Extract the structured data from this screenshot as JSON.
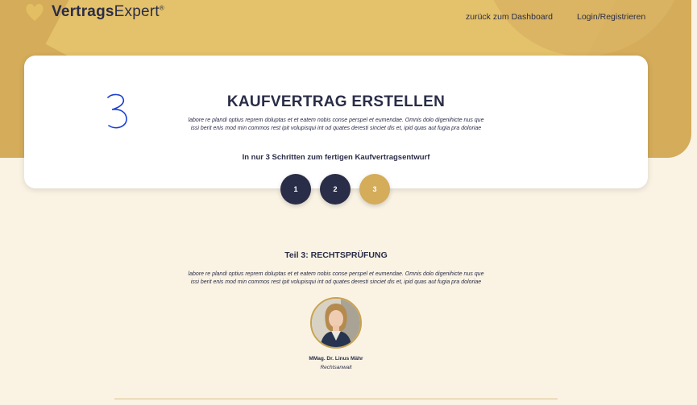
{
  "header": {
    "logo": {
      "bold": "Vertrags",
      "regular": "Expert",
      "reg": "®"
    },
    "nav": {
      "dashboard": "zurück zum Dashboard",
      "login": "Login/Registrieren"
    }
  },
  "card": {
    "title": "KAUFVERTRAG ERSTELLEN",
    "lorem_line1": "labore re plandi optius reprem doluptas et et eatem nobis conse perspel et eumendae. Omnis dolo digenihicte nus que",
    "lorem_line2": "issi berit enis mod min commos rest ipit volupisqui int od quates deresti sinciet dis et, ipid quas aut fugia pra doloriae",
    "steps_caption": "In nur 3 Schritten zum fertigen Kaufvertragsentwurf"
  },
  "steps": [
    {
      "label": "1",
      "state": "done",
      "color": "#2a2d47"
    },
    {
      "label": "2",
      "state": "done",
      "color": "#2a2d47"
    },
    {
      "label": "3",
      "state": "active",
      "color": "#d4ac5a"
    }
  ],
  "section": {
    "title": "Teil 3: RECHTSPRÜFUNG",
    "lorem_line1": "labore re plandi optius reprem doluptas et et eatem nobis conse perspel et eumendae. Omnis dolo digenihicte nus que",
    "lorem_line2": "issi berit enis mod min commos rest ipit volupisqui int od quates deresti sinciet dis et, ipid quas aut fugia pra doloriae"
  },
  "lawyer": {
    "name": "MMag. Dr. Linus Mähr",
    "role": "Rechtsanwalt"
  },
  "colors": {
    "navy": "#2a2d47",
    "gold": "#d4ac5a",
    "cream": "#faf3e4"
  }
}
